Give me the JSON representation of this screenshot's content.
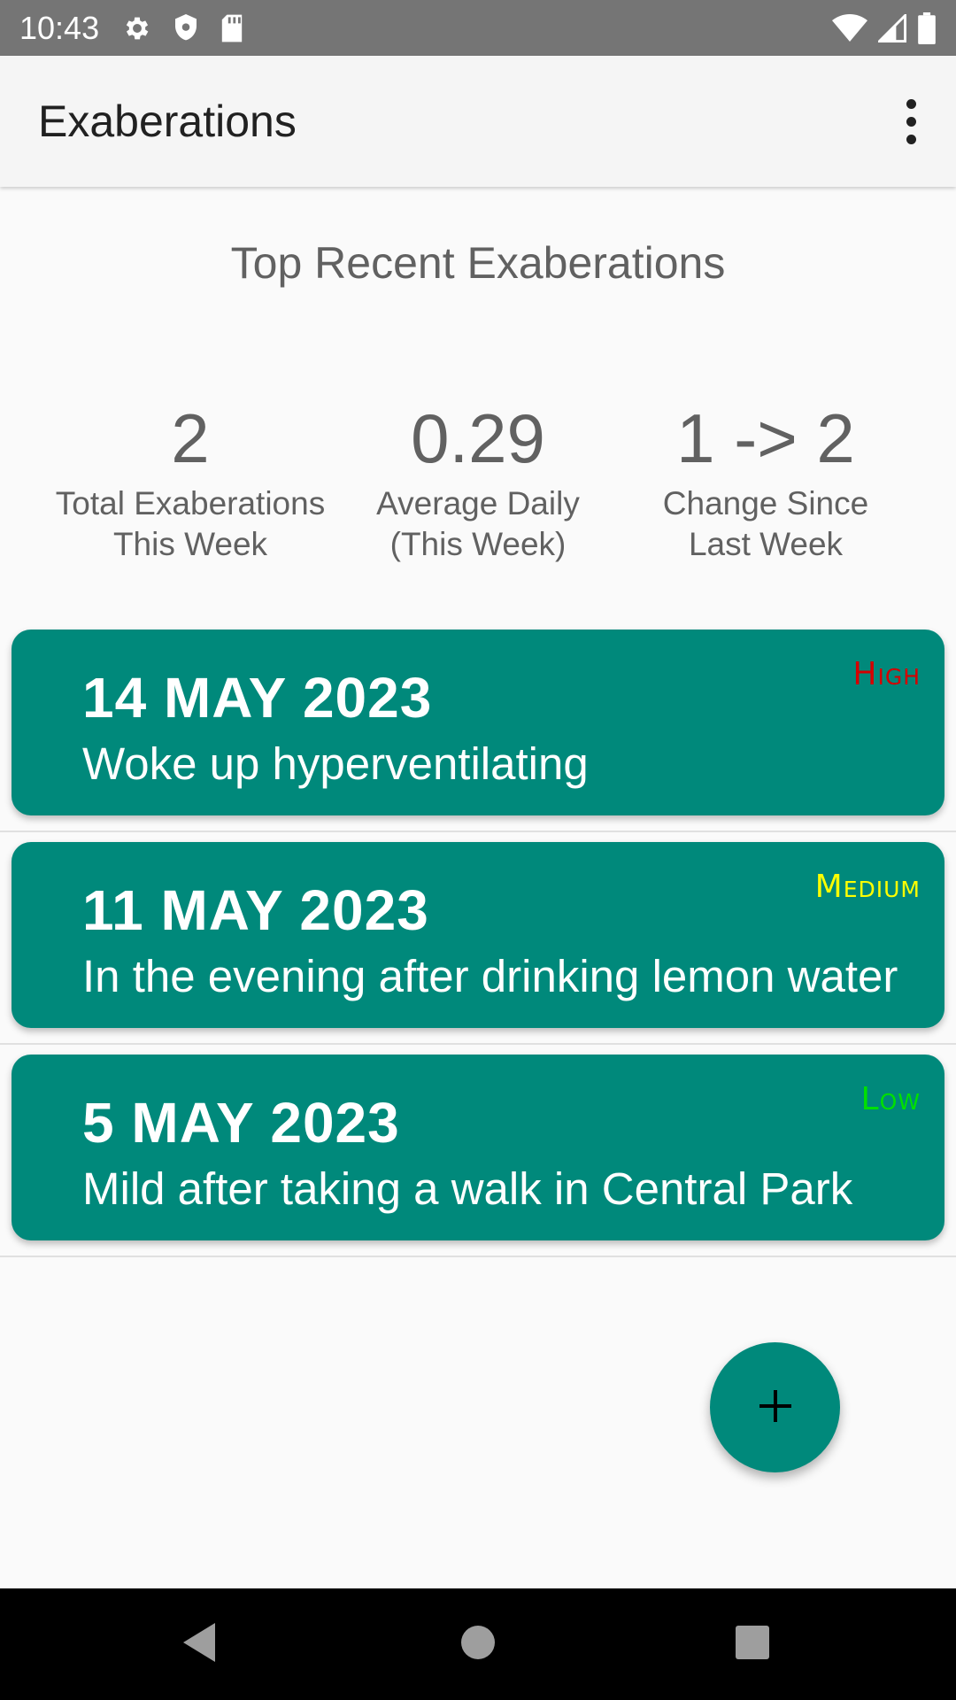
{
  "status_bar": {
    "time": "10:43",
    "icons_left": [
      "settings-icon",
      "shield-icon",
      "sd-card-icon"
    ],
    "icons_right": [
      "wifi-icon",
      "signal-icon",
      "battery-icon"
    ]
  },
  "app_bar": {
    "title": "Exaberations",
    "menu_icon": "more-vert-icon"
  },
  "section_title": "Top Recent Exaberations",
  "stats": [
    {
      "value": "2",
      "label_line1": "Total Exaberations",
      "label_line2": "This Week"
    },
    {
      "value": "0.29",
      "label_line1": "Average Daily",
      "label_line2": "(This Week)"
    },
    {
      "value": "1 -> 2",
      "label_line1": "Change Since",
      "label_line2": "Last Week"
    }
  ],
  "entries": [
    {
      "date": "14 MAY 2023",
      "description": "Woke up hyperventilating",
      "severity": "High",
      "severity_color": "#d50000"
    },
    {
      "date": "11 MAY 2023",
      "description": "In the evening after drinking lemon water",
      "severity": "Medium",
      "severity_color": "#ffff00"
    },
    {
      "date": "5 MAY 2023",
      "description": "Mild after taking a walk in Central Park",
      "severity": "Low",
      "severity_color": "#00e000"
    }
  ],
  "fab": {
    "icon": "plus-icon"
  },
  "nav_bar": {
    "buttons": [
      "back-icon",
      "home-icon",
      "recents-icon"
    ]
  },
  "colors": {
    "card_background": "#00897b",
    "status_bar": "#757575",
    "app_bar": "#f5f5f5",
    "background": "#fafafa"
  }
}
